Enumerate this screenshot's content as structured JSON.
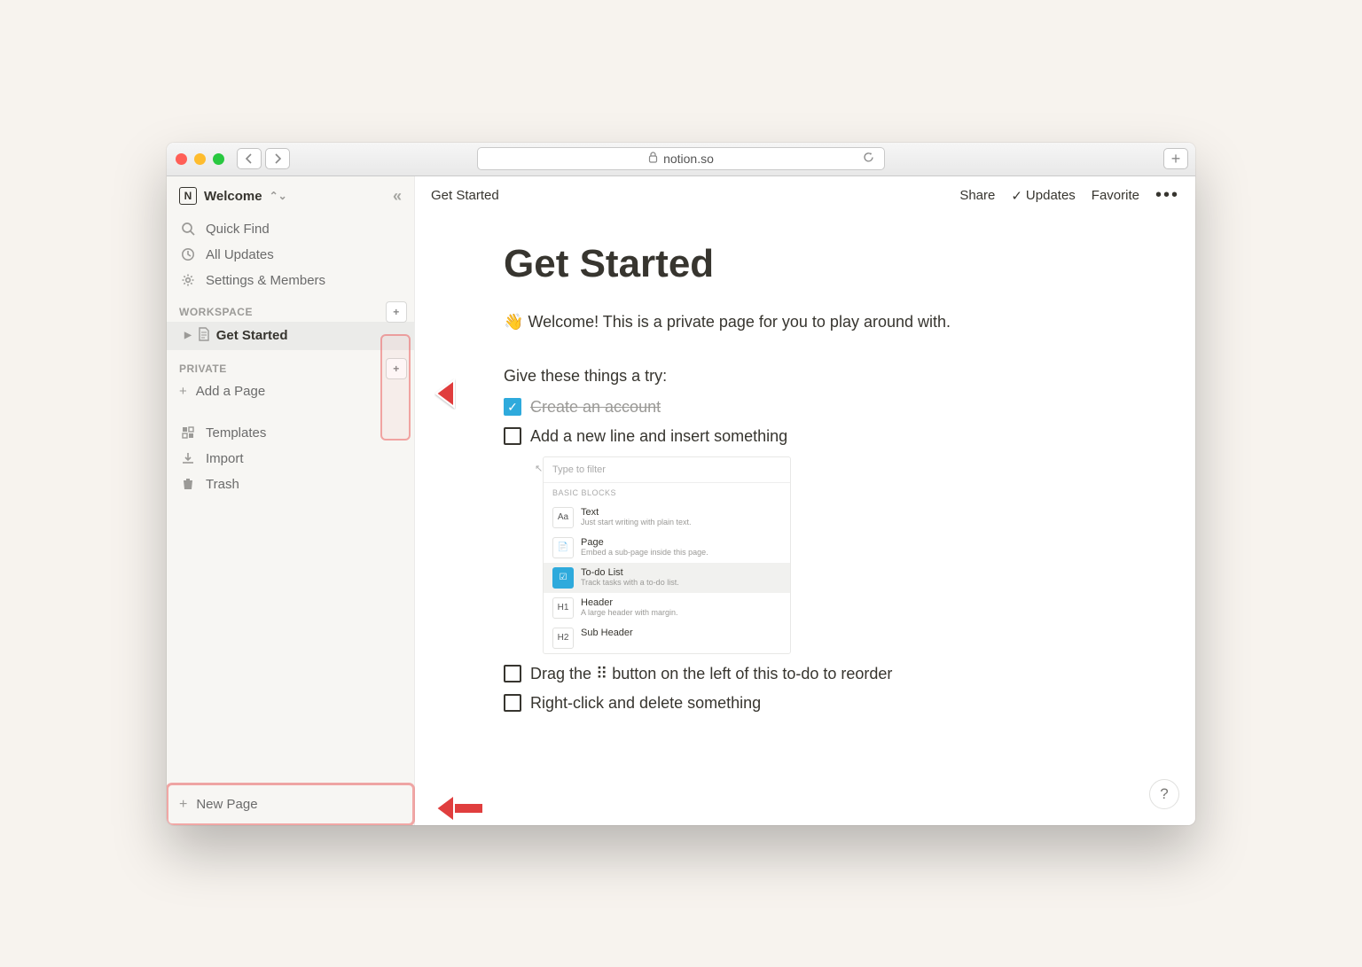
{
  "browser": {
    "url": "notion.so"
  },
  "sidebar": {
    "workspace_name": "Welcome",
    "quick_find": "Quick Find",
    "all_updates": "All Updates",
    "settings": "Settings & Members",
    "section_workspace": "WORKSPACE",
    "page_get_started": "Get Started",
    "section_private": "PRIVATE",
    "add_page": "Add a Page",
    "templates": "Templates",
    "import": "Import",
    "trash": "Trash",
    "new_page": "New Page"
  },
  "topbar": {
    "breadcrumb": "Get Started",
    "share": "Share",
    "updates": "Updates",
    "favorite": "Favorite"
  },
  "content": {
    "title": "Get Started",
    "welcome": "Welcome! This is a private page for you to play around with.",
    "try": "Give these things a try:",
    "todos": {
      "t0": "Create an account",
      "t1": "Add a new line and insert something",
      "t2": "Drag the ⠿ button on the left of this to-do to reorder",
      "t3": "Right-click and delete something"
    }
  },
  "menu": {
    "search_placeholder": "Type to filter",
    "section": "BASIC BLOCKS",
    "items": {
      "text": {
        "title": "Text",
        "sub": "Just start writing with plain text."
      },
      "page": {
        "title": "Page",
        "sub": "Embed a sub-page inside this page."
      },
      "todo": {
        "title": "To-do List",
        "sub": "Track tasks with a to-do list."
      },
      "header": {
        "title": "Header",
        "sub": "A large header with margin."
      },
      "subheader": {
        "title": "Sub Header"
      }
    }
  },
  "help": "?"
}
